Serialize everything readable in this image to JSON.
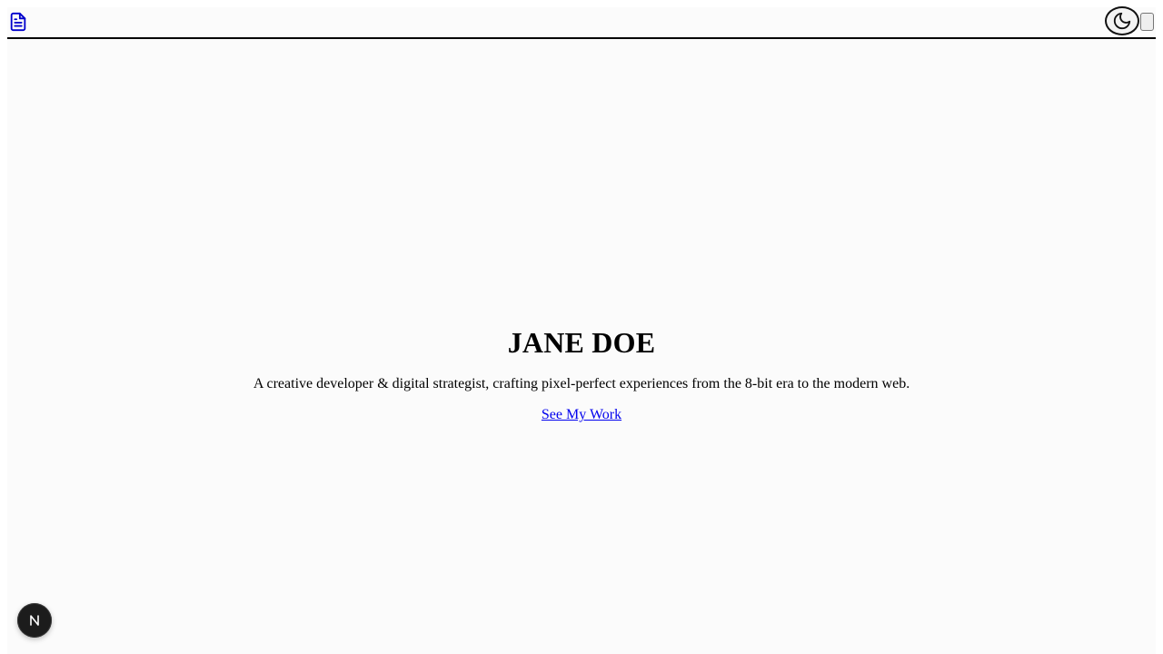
{
  "header": {
    "document_icon": "document-icon",
    "theme_toggle_icon": "moon-icon",
    "accent_color": "#0000cc"
  },
  "hero": {
    "title": "JANE DOE",
    "tagline": "A creative developer & digital strategist, crafting pixel-perfect experiences from the 8-bit era to the modern web.",
    "cta_label": "See My Work",
    "link_color": "#0000ee"
  },
  "dev_badge": {
    "letter": "N",
    "background": "#1c1c1c"
  }
}
